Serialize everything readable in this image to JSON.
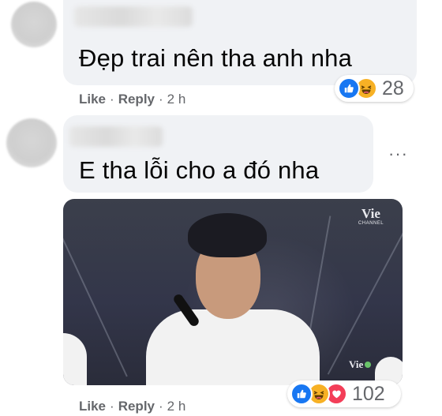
{
  "comments": [
    {
      "text": "Đẹp trai nên tha anh nha",
      "actions": {
        "like": "Like",
        "reply": "Reply",
        "sep": "·",
        "time": "2 h"
      },
      "reactions": {
        "types": [
          "like-icon",
          "haha-icon"
        ],
        "count": "28"
      }
    },
    {
      "text": "E tha lỗi cho a đó nha",
      "actions": {
        "like": "Like",
        "reply": "Reply",
        "sep": "·",
        "time": "2 h"
      },
      "more_options": "···",
      "photo": {
        "logo_top": "Vie",
        "logo_top_sub": "CHANNEL",
        "logo_bottom": "Vie"
      },
      "reactions": {
        "types": [
          "like-icon",
          "haha-icon",
          "love-icon"
        ],
        "count": "102"
      }
    }
  ],
  "colors": {
    "bubble": "#f0f2f5",
    "like": "#1877f2",
    "haha": "#f7b125",
    "love": "#f33e58",
    "meta_text": "#65676b"
  }
}
